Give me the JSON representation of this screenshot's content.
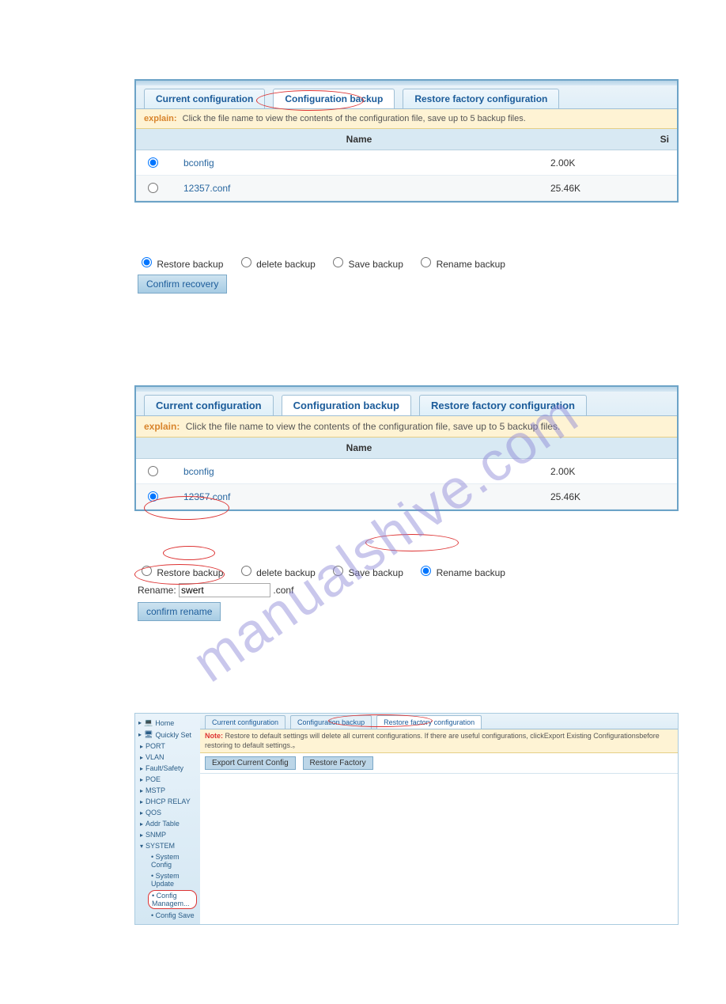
{
  "shot1": {
    "tabs": [
      "Current configuration",
      "Configuration backup",
      "Restore factory configuration"
    ],
    "active_tab": 1,
    "explain_label": "explain:",
    "explain": "Click the file name to view the contents of the configuration file, save up to 5 backup files.",
    "col_name": "Name",
    "col_size": "Si",
    "rows": [
      {
        "name": "bconfig",
        "size": "2.00K",
        "selected": true
      },
      {
        "name": "12357.conf",
        "size": "25.46K",
        "selected": false
      }
    ],
    "actions": [
      "Restore backup",
      "delete backup",
      "Save backup",
      "Rename backup"
    ],
    "action_selected": 0,
    "btn": "Confirm recovery"
  },
  "shot2": {
    "tabs": [
      "Current configuration",
      "Configuration backup",
      "Restore factory configuration"
    ],
    "active_tab": 1,
    "explain_label": "explain:",
    "explain": "Click the file name to view the contents of the configuration file, save up to 5 backup files.",
    "col_name": "Name",
    "col_size": "",
    "rows": [
      {
        "name": "bconfig",
        "size": "2.00K",
        "selected": false
      },
      {
        "name": "12357.conf",
        "size": "25.46K",
        "selected": true
      }
    ],
    "actions": [
      "Restore backup",
      "delete backup",
      "Save backup",
      "Rename backup"
    ],
    "action_selected": 3,
    "rename_label": "Rename:",
    "rename_value": "swert",
    "rename_suffix": ".conf",
    "btn": "confirm rename"
  },
  "shot3": {
    "nav_home": "Home",
    "nav_quick": "Quickly Set",
    "nav": [
      "PORT",
      "VLAN",
      "Fault/Safety",
      "POE",
      "MSTP",
      "DHCP RELAY",
      "QOS",
      "Addr Table",
      "SNMP"
    ],
    "nav_system": "SYSTEM",
    "nav_sub": [
      "System Config",
      "System Update",
      "Config Managem...",
      "Config Save"
    ],
    "tabs": [
      "Current configuration",
      "Configuration backup",
      "Restore factory configuration"
    ],
    "active_tab": 2,
    "note_label": "Note:",
    "note": "Restore to default settings will delete all current configurations. If there are useful configurations, clickExport Existing Configurationsbefore restoring to default settings.。",
    "btn1": "Export Current Config",
    "btn2": "Restore Factory"
  },
  "watermark": "manualshive.com"
}
